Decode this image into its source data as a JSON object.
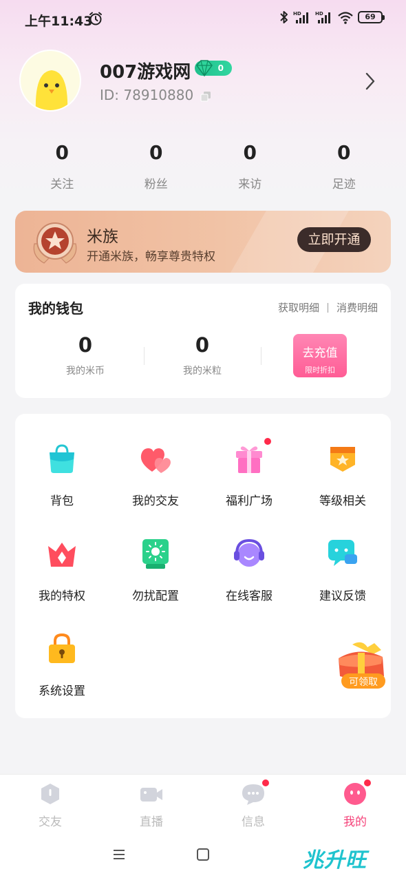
{
  "status_bar": {
    "time": "上午11:43",
    "battery": "69"
  },
  "profile": {
    "nickname": "007游戏网",
    "vip_level": "0",
    "user_id": "ID: 78910880"
  },
  "stats": [
    {
      "value": "0",
      "label": "关注"
    },
    {
      "value": "0",
      "label": "粉丝"
    },
    {
      "value": "0",
      "label": "来访"
    },
    {
      "value": "0",
      "label": "足迹"
    }
  ],
  "membership": {
    "title": "米族",
    "subtitle": "开通米族，畅享尊贵特权",
    "button": "立即开通"
  },
  "wallet": {
    "title": "我的钱包",
    "link_income": "获取明细",
    "link_expense": "消费明细",
    "coins_value": "0",
    "coins_label": "我的米币",
    "grains_value": "0",
    "grains_label": "我的米粒",
    "recharge_label": "去充值",
    "recharge_sub": "限时折扣"
  },
  "menu": [
    {
      "label": "背包",
      "icon": "bag-icon"
    },
    {
      "label": "我的交友",
      "icon": "hearts-icon"
    },
    {
      "label": "福利广场",
      "icon": "gift-icon"
    },
    {
      "label": "等级相关",
      "icon": "level-badge-icon"
    },
    {
      "label": "我的特权",
      "icon": "crown-icon"
    },
    {
      "label": "勿扰配置",
      "icon": "do-not-disturb-icon"
    },
    {
      "label": "在线客服",
      "icon": "customer-service-icon"
    },
    {
      "label": "建议反馈",
      "icon": "feedback-icon"
    },
    {
      "label": "系统设置",
      "icon": "lock-settings-icon"
    }
  ],
  "floating_gift": {
    "label": "可领取"
  },
  "tabbar": [
    {
      "label": "交友",
      "active": false
    },
    {
      "label": "直播",
      "active": false
    },
    {
      "label": "信息",
      "active": false
    },
    {
      "label": "我的",
      "active": true
    }
  ],
  "watermark": "兆升旺",
  "colors": {
    "accent": "#f5437a",
    "recharge": "#ff5c95",
    "vip_green": "#1fbf8c",
    "banner_bg": "#edb495"
  }
}
